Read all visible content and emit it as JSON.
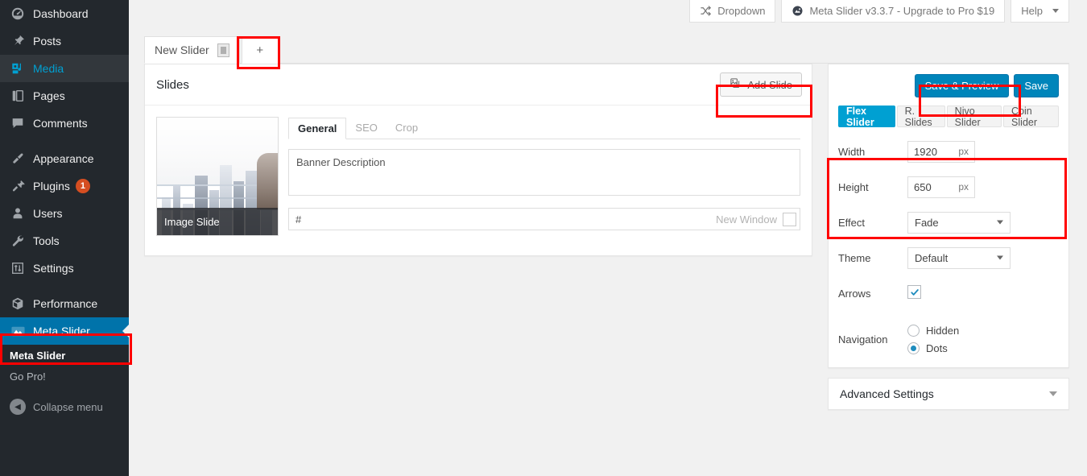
{
  "sidebar": {
    "items": [
      {
        "label": "Dashboard",
        "icon": "dashboard-icon",
        "state": "normal"
      },
      {
        "label": "Posts",
        "icon": "pin-icon",
        "state": "normal"
      },
      {
        "label": "Media",
        "icon": "media-icon",
        "state": "current"
      },
      {
        "label": "Pages",
        "icon": "pages-icon",
        "state": "normal"
      },
      {
        "label": "Comments",
        "icon": "comments-icon",
        "state": "normal"
      },
      {
        "label": "Appearance",
        "icon": "brush-icon",
        "state": "normal"
      },
      {
        "label": "Plugins",
        "icon": "plug-icon",
        "state": "normal",
        "badge": "1"
      },
      {
        "label": "Users",
        "icon": "user-icon",
        "state": "normal"
      },
      {
        "label": "Tools",
        "icon": "wrench-icon",
        "state": "normal"
      },
      {
        "label": "Settings",
        "icon": "sliders-icon",
        "state": "normal"
      },
      {
        "label": "Performance",
        "icon": "cube-icon",
        "state": "normal"
      },
      {
        "label": "Meta Slider",
        "icon": "meta-slider-icon",
        "state": "active"
      }
    ],
    "submenu": [
      {
        "label": "Meta Slider",
        "current": true
      },
      {
        "label": "Go Pro!",
        "current": false
      }
    ],
    "collapse_label": "Collapse menu",
    "badge_color": "#d54e21",
    "active_color": "#0073aa"
  },
  "topbar": {
    "dropdown_label": "Dropdown",
    "version_label": "Meta Slider v3.3.7 - Upgrade to Pro $19",
    "help_label": "Help"
  },
  "slider_tabs": {
    "current": "New Slider",
    "add_label": "+"
  },
  "slides_panel": {
    "title": "Slides",
    "add_slide_label": "Add Slide",
    "slide": {
      "caption": "Image Slide",
      "tabs": [
        {
          "label": "General",
          "active": true
        },
        {
          "label": "SEO",
          "active": false
        },
        {
          "label": "Crop",
          "active": false
        }
      ],
      "description": "Banner Description",
      "url": "#",
      "new_window_label": "New Window",
      "new_window_checked": false
    }
  },
  "settings": {
    "save_preview_label": "Save & Preview",
    "save_label": "Save",
    "type_tabs": [
      {
        "label": "Flex Slider",
        "active": true
      },
      {
        "label": "R. Slides",
        "active": false
      },
      {
        "label": "Nivo Slider",
        "active": false
      },
      {
        "label": "Coin Slider",
        "active": false
      }
    ],
    "width": {
      "label": "Width",
      "value": "1920",
      "unit": "px"
    },
    "height": {
      "label": "Height",
      "value": "650",
      "unit": "px"
    },
    "effect": {
      "label": "Effect",
      "value": "Fade"
    },
    "theme": {
      "label": "Theme",
      "value": "Default"
    },
    "arrows": {
      "label": "Arrows",
      "checked": true
    },
    "navigation": {
      "label": "Navigation",
      "options": [
        {
          "label": "Hidden",
          "selected": false
        },
        {
          "label": "Dots",
          "selected": true
        }
      ]
    },
    "advanced_label": "Advanced Settings",
    "primary_color": "#0085ba",
    "accent_color": "#00a0d2"
  },
  "annotations": {
    "highlight_color": "#ff0000",
    "boxes": [
      "meta-slider-menu",
      "add-tab",
      "add-slide-button",
      "save-preview-button",
      "dimensions-group"
    ]
  }
}
